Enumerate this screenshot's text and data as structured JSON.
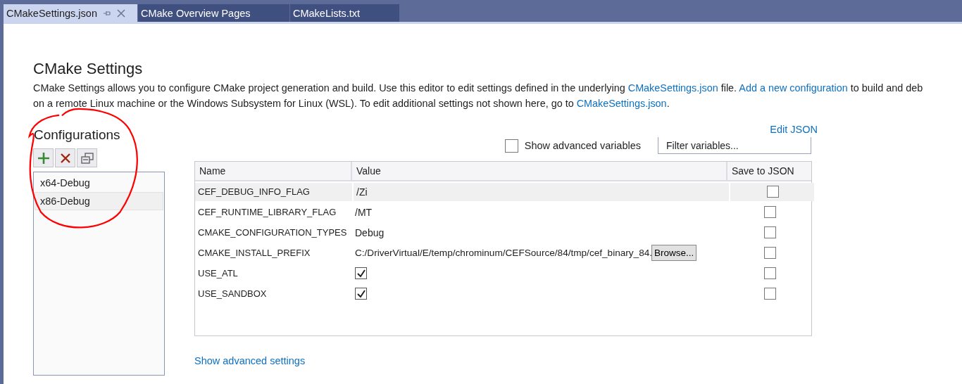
{
  "tabs": [
    {
      "label": "CMakeSettings.json",
      "selected": true,
      "pinned": true,
      "closable": true
    },
    {
      "label": "CMake Overview Pages",
      "selected": false,
      "pinned": false,
      "closable": false
    },
    {
      "label": "CMakeLists.txt",
      "selected": false,
      "pinned": false,
      "closable": false
    }
  ],
  "title": "CMake Settings",
  "description": [
    [
      {
        "kind": "text",
        "text": "CMake Settings allows you to configure CMake project generation and build. Use this editor to edit settings defined in the underlying "
      },
      {
        "kind": "link",
        "text": "CMakeSettings.json"
      },
      {
        "kind": "text",
        "text": " file. "
      },
      {
        "kind": "link",
        "text": "Add a new configuration"
      },
      {
        "kind": "text",
        "text": " to build and deb"
      }
    ],
    [
      {
        "kind": "text",
        "text": "on a remote Linux machine or the Windows Subsystem for Linux (WSL). To edit additional settings not shown here, go to "
      },
      {
        "kind": "link",
        "text": "CMakeSettings.json"
      },
      {
        "kind": "text",
        "text": "."
      }
    ]
  ],
  "configurations": {
    "heading": "Configurations",
    "items": [
      {
        "label": "x64-Debug",
        "selected": false
      },
      {
        "label": "x86-Debug",
        "selected": true
      }
    ]
  },
  "edit_json": "Edit JSON",
  "show_advanced_variables": {
    "label": "Show advanced variables",
    "checked": false
  },
  "filter": {
    "placeholder": "Filter variables..."
  },
  "table": {
    "columns": [
      "Name",
      "Value",
      "Save to JSON"
    ],
    "rows": [
      {
        "name": "CEF_DEBUG_INFO_FLAG",
        "kind": "text",
        "value": "/Zi",
        "save_to_json": false,
        "selected": true
      },
      {
        "name": "CEF_RUNTIME_LIBRARY_FLAG",
        "kind": "text",
        "value": "/MT",
        "save_to_json": false,
        "selected": false
      },
      {
        "name": "CMAKE_CONFIGURATION_TYPES",
        "kind": "text",
        "value": "Debug",
        "save_to_json": false,
        "selected": false
      },
      {
        "name": "CMAKE_INSTALL_PREFIX",
        "kind": "path",
        "value": "C:/DriverVirtual/E/temp/chrominum/CEFSource/84/tmp/cef_binary_84.",
        "button": "Browse...",
        "save_to_json": false,
        "selected": false
      },
      {
        "name": "USE_ATL",
        "kind": "checkbox",
        "checked": true,
        "save_to_json": false,
        "selected": false
      },
      {
        "name": "USE_SANDBOX",
        "kind": "checkbox",
        "checked": true,
        "save_to_json": false,
        "selected": false
      }
    ]
  },
  "show_advanced_settings": "Show advanced settings"
}
